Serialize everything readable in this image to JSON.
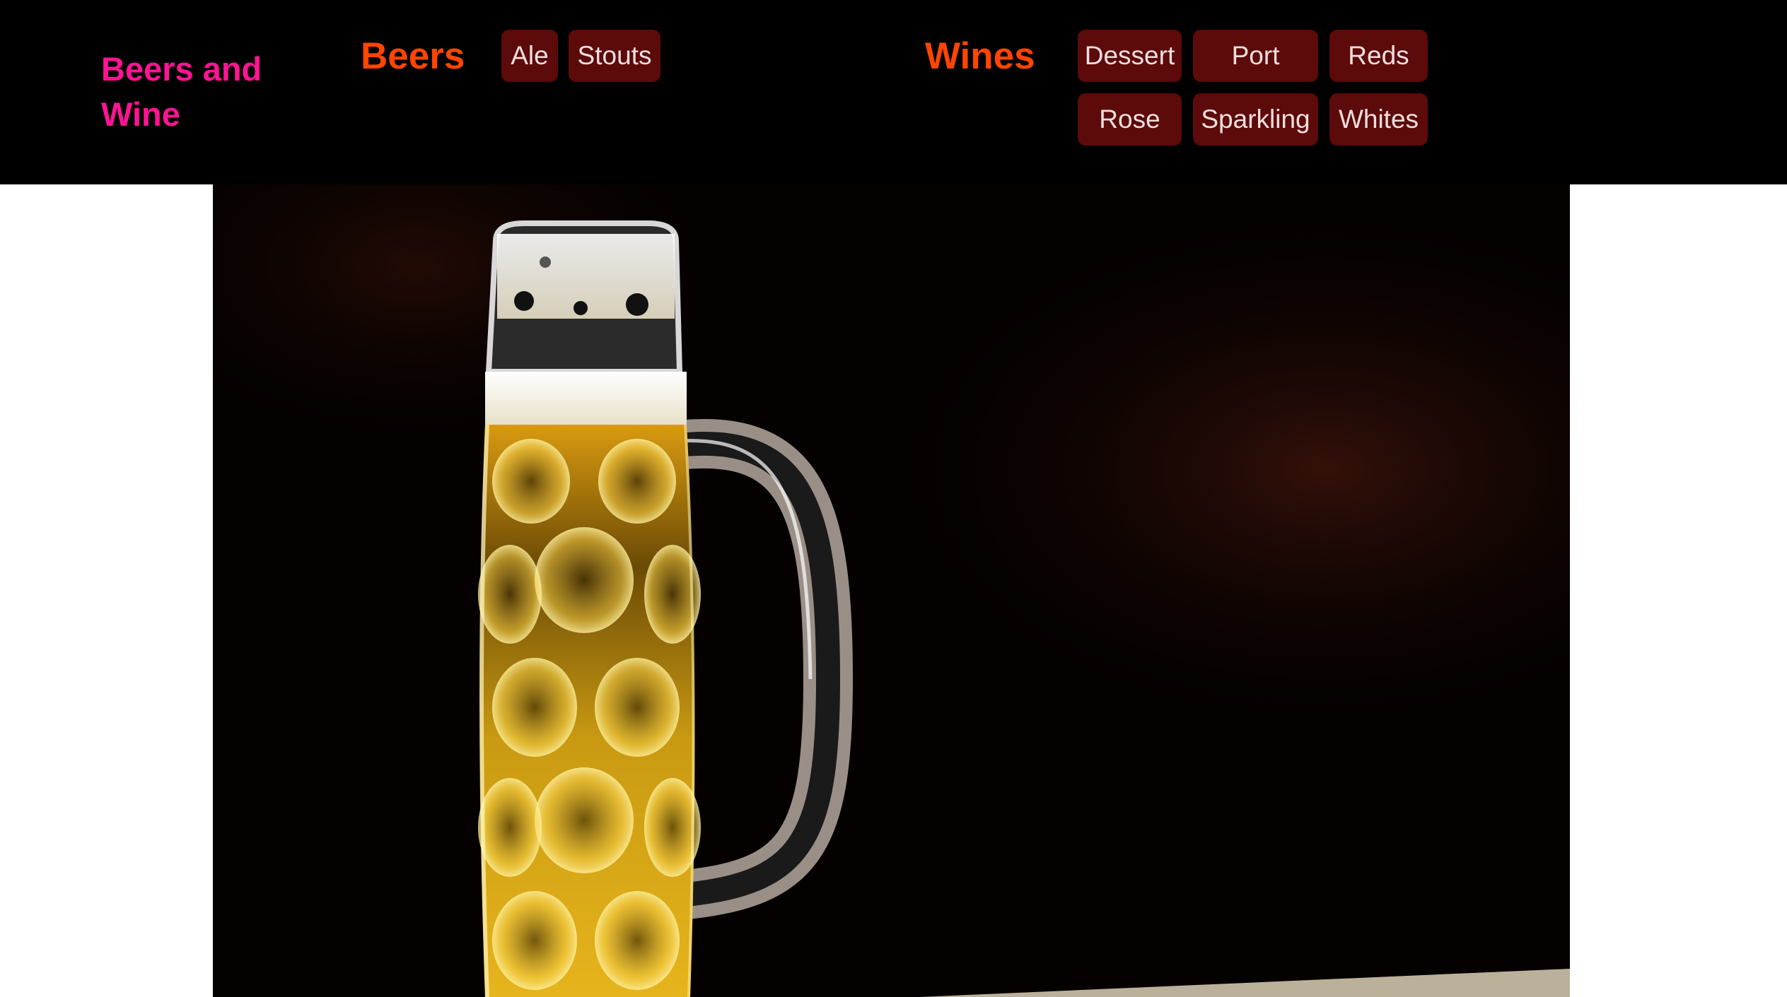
{
  "brand": {
    "title": "Beers and Wine"
  },
  "beers": {
    "heading": "Beers",
    "buttons": [
      "Ale",
      "Stouts"
    ]
  },
  "wines": {
    "heading": "Wines",
    "buttons": [
      "Dessert",
      "Port",
      "Reds",
      "Rose",
      "Sparkling",
      "Whites"
    ]
  },
  "colors": {
    "header_bg": "#000000",
    "brand": "#ff1493",
    "heading": "#ff4500",
    "button_bg": "#5c0a0a",
    "button_text": "#f4dede"
  },
  "hero": {
    "subject": "beer-mug-photo"
  }
}
